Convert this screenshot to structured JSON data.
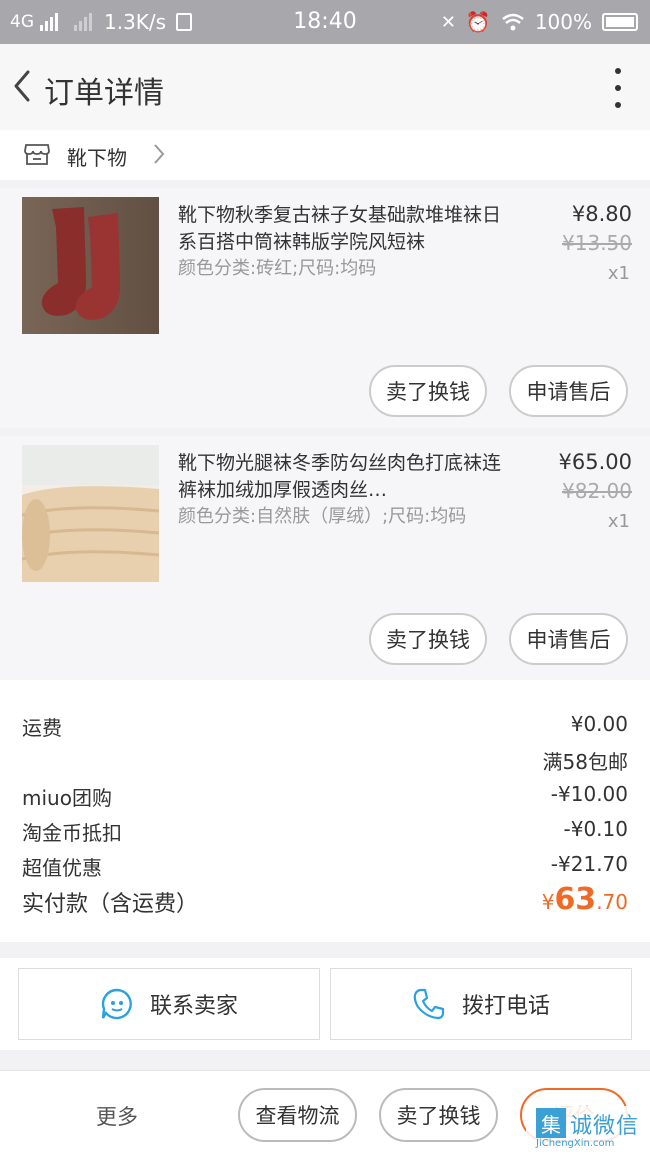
{
  "status_bar": {
    "network": "4G",
    "speed": "1.3K/s",
    "time": "18:40",
    "battery": "100%"
  },
  "header": {
    "title": "订单详情"
  },
  "shop": {
    "name": "靴下物"
  },
  "items": [
    {
      "title": "靴下物秋季复古袜子女基础款堆堆袜日系百搭中筒袜韩版学院风短袜",
      "sku": "颜色分类:砖红;尺码:均码",
      "price": "¥8.80",
      "original_price": "¥13.50",
      "quantity": "x1",
      "image_color": "#8a2e2c",
      "actions": [
        "卖了换钱",
        "申请售后"
      ]
    },
    {
      "title": "靴下物光腿袜冬季防勾丝肉色打底袜连裤袜加绒加厚假透肉丝…",
      "sku": "颜色分类:自然肤（厚绒）;尺码:均码",
      "price": "¥65.00",
      "original_price": "¥82.00",
      "quantity": "x1",
      "image_color": "#e8cfae",
      "actions": [
        "卖了换钱",
        "申请售后"
      ]
    }
  ],
  "summary": {
    "shipping_label": "运费",
    "shipping_value": "¥0.00",
    "shipping_note": "满58包邮",
    "group_label": "miuo团购",
    "group_value": "-¥10.00",
    "coin_label": "淘金币抵扣",
    "coin_value": "-¥0.10",
    "discount_label": "超值优惠",
    "discount_value": "-¥21.70",
    "total_label": "实付款（含运费）",
    "total_currency": "¥",
    "total_int": "63",
    "total_dec": ".70",
    "accent_color": "#f06a25"
  },
  "contact": {
    "seller_label": "联系卖家",
    "phone_label": "拨打电话"
  },
  "bottom_bar": {
    "more": "更多",
    "logistics": "查看物流",
    "resell": "卖了换钱",
    "review": "评价"
  },
  "watermark": {
    "box": "集",
    "text": "诚微信",
    "sub": "JiChengXin.com"
  }
}
